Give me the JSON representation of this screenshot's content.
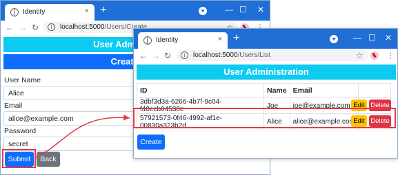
{
  "back_window": {
    "tab_title": "Identity",
    "tab_close": "×",
    "new_tab": "+",
    "controls": {
      "minimize": "—",
      "maximize": "☐",
      "close": "✕"
    },
    "url_host": "localhost:5000",
    "url_path": "/Users/Create",
    "page": {
      "header": "User Administration",
      "subheader": "Create User",
      "fields": [
        {
          "label": "User Name",
          "value": "Alice"
        },
        {
          "label": "Email",
          "value": "alice@example.com"
        },
        {
          "label": "Password",
          "value": "secret"
        }
      ],
      "submit_label": "Submit",
      "back_label": "Back"
    }
  },
  "front_window": {
    "tab_title": "Identity",
    "tab_close": "×",
    "new_tab": "+",
    "controls": {
      "minimize": "—",
      "maximize": "☐",
      "close": "✕"
    },
    "url_host": "localhost:5000",
    "url_path": "/Users/List",
    "page": {
      "header": "User Administration",
      "columns": [
        "ID",
        "Name",
        "Email",
        ""
      ],
      "rows": [
        {
          "id": "3dbf3d3a-6266-4b7f-9c04-f40ecb04538e",
          "name": "Joe",
          "email": "joe@example.com"
        },
        {
          "id": "57921573-0f46-4992-af1e-00830a323b2d",
          "name": "Alice",
          "email": "alice@example.com"
        }
      ],
      "edit_label": "Edit",
      "delete_label": "Delete",
      "create_label": "Create"
    }
  },
  "icons": {
    "back": "←",
    "forward": "→",
    "reload": "↻",
    "star": "☆",
    "kebab": "⋮"
  },
  "colors": {
    "titlebar": "#1f6fd6",
    "header_cyan": "#0dcaf0",
    "primary": "#0d6efd",
    "secondary": "#6c757d",
    "warning": "#ffc107",
    "danger": "#dc3545",
    "highlight": "#e53946"
  }
}
